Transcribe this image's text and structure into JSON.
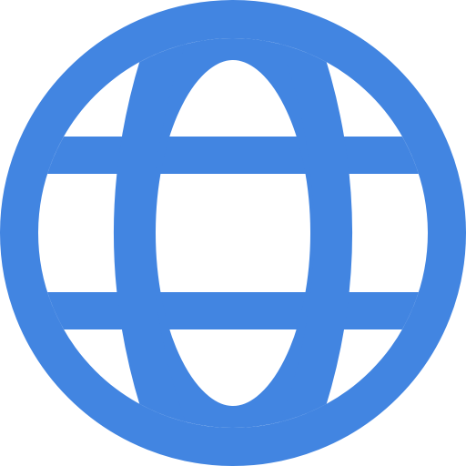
{
  "icon": {
    "name": "globe-icon",
    "color": "#4285E1",
    "background": "#FFFFFF"
  }
}
